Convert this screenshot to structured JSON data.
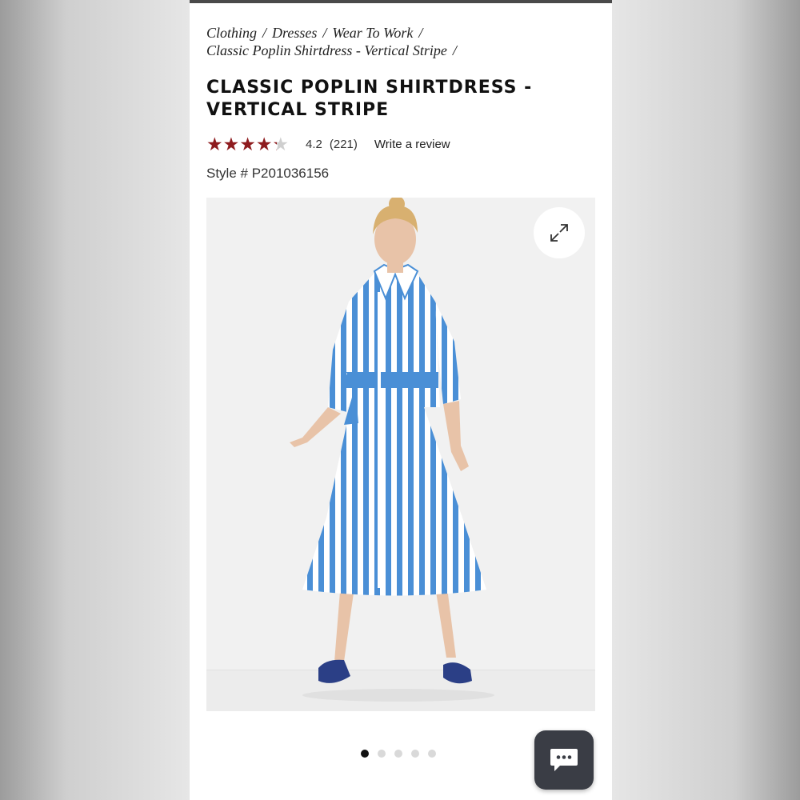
{
  "breadcrumbs": {
    "items": [
      "Clothing",
      "Dresses",
      "Wear To Work",
      "Classic Poplin Shirtdress - Vertical Stripe"
    ],
    "separator": "/"
  },
  "product": {
    "title": "CLASSIC POPLIN SHIRTDRESS - VERTICAL STRIPE",
    "rating": "4.2",
    "rating_value": 4.2,
    "rating_max": 5,
    "review_count": "(221)",
    "write_review_label": "Write a review",
    "style_number": "Style # P201036156"
  },
  "gallery": {
    "image_count": 5,
    "active_index": 0,
    "expand_icon": "expand-arrows-icon"
  },
  "chat": {
    "icon": "chat-bubble-icon"
  },
  "colors": {
    "star": "#8e1b1e",
    "dress_stripe": "#4a8fd6",
    "chat_button": "#3a3d45"
  }
}
